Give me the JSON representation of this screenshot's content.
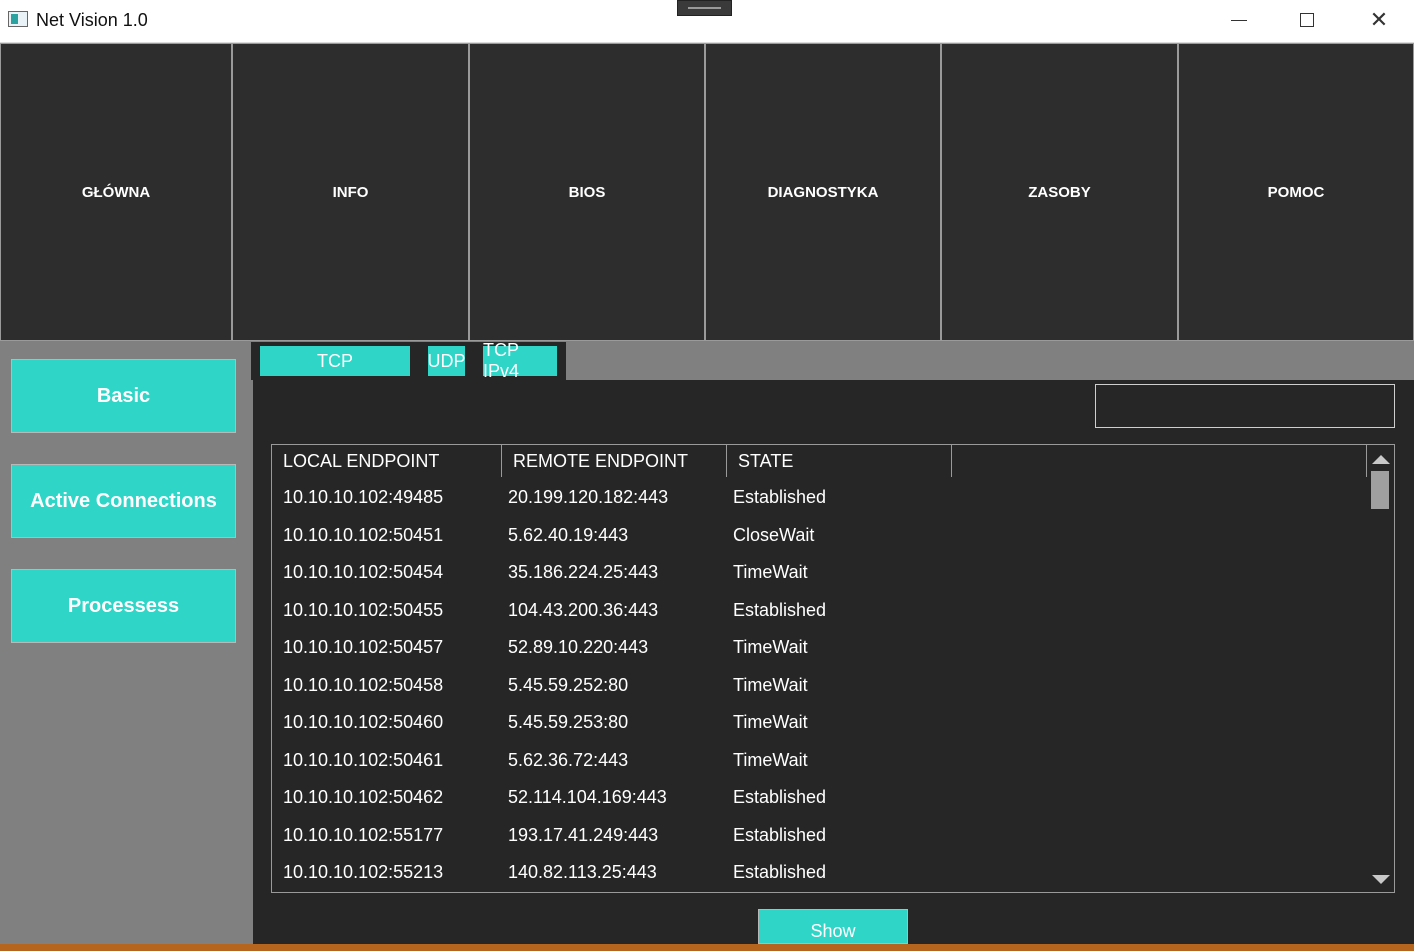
{
  "window": {
    "title": "Net Vision 1.0",
    "controls": {
      "minimize": "minimize",
      "maximize": "maximize",
      "close": "✕"
    }
  },
  "nav": {
    "items": [
      "GŁÓWNA",
      "INFO",
      "BIOS",
      "DIAGNOSTYKA",
      "ZASOBY",
      "POMOC"
    ]
  },
  "sidebar": {
    "items": [
      "Basic",
      "Active Connections",
      "Processess"
    ]
  },
  "tabs": {
    "items": [
      "TCP",
      "UDP",
      "TCP IPv4"
    ]
  },
  "search": {
    "value": ""
  },
  "table": {
    "columns": [
      "LOCAL ENDPOINT",
      "REMOTE ENDPOINT",
      "STATE"
    ],
    "rows": [
      [
        "10.10.10.102:49485",
        "20.199.120.182:443",
        "Established"
      ],
      [
        "10.10.10.102:50451",
        "5.62.40.19:443",
        "CloseWait"
      ],
      [
        "10.10.10.102:50454",
        "35.186.224.25:443",
        "TimeWait"
      ],
      [
        "10.10.10.102:50455",
        "104.43.200.36:443",
        "Established"
      ],
      [
        "10.10.10.102:50457",
        "52.89.10.220:443",
        "TimeWait"
      ],
      [
        "10.10.10.102:50458",
        "5.45.59.252:80",
        "TimeWait"
      ],
      [
        "10.10.10.102:50460",
        "5.45.59.253:80",
        "TimeWait"
      ],
      [
        "10.10.10.102:50461",
        "5.62.36.72:443",
        "TimeWait"
      ],
      [
        "10.10.10.102:50462",
        "52.114.104.169:443",
        "Established"
      ],
      [
        "10.10.10.102:55177",
        "193.17.41.249:443",
        "Established"
      ],
      [
        "10.10.10.102:55213",
        "140.82.113.25:443",
        "Established"
      ]
    ]
  },
  "actions": {
    "show_label": "Show"
  },
  "colors": {
    "accent": "#2fd5c7",
    "panel": "#262626",
    "nav": "#2d2d2d",
    "background": "#808080"
  }
}
